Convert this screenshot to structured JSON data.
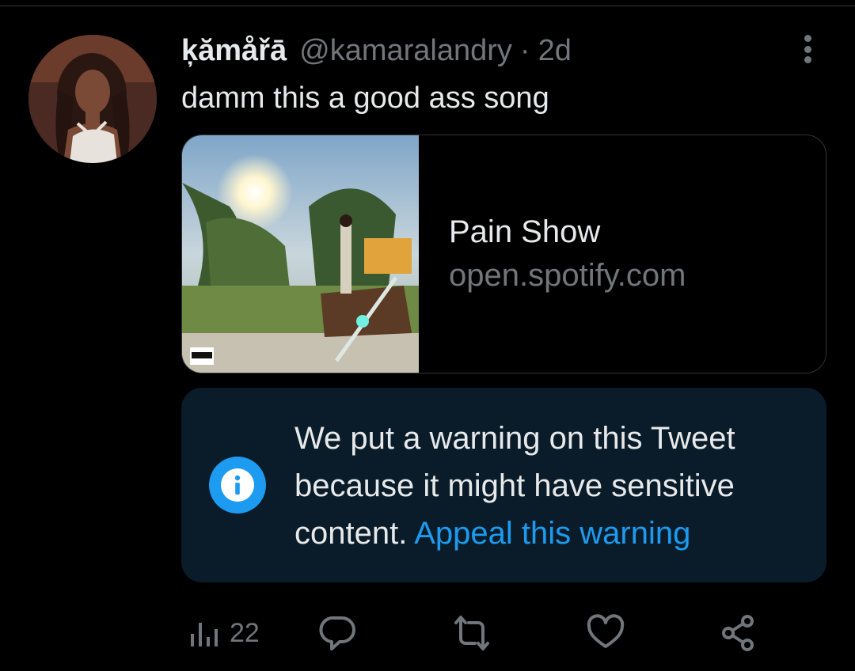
{
  "tweet": {
    "display_name": "ķămåřā",
    "handle": "@kamaralandry",
    "separator": "·",
    "time": "2d",
    "text": "damm this a good ass song"
  },
  "card": {
    "title": "Pain Show",
    "domain": "open.spotify.com"
  },
  "warning": {
    "message": "We put a warning on this Tweet because it might have sensitive content.",
    "link": "Appeal this warning"
  },
  "actions": {
    "views": "22"
  },
  "icons": {
    "more": "more-vertical-icon",
    "info": "info-icon",
    "views": "analytics-icon",
    "reply": "reply-icon",
    "retweet": "retweet-icon",
    "like": "heart-icon",
    "share": "share-icon"
  },
  "colors": {
    "background": "#000000",
    "text": "#e7e9ea",
    "muted": "#71767b",
    "accent": "#1d9bf0",
    "warning_bg": "#0a1c29"
  }
}
